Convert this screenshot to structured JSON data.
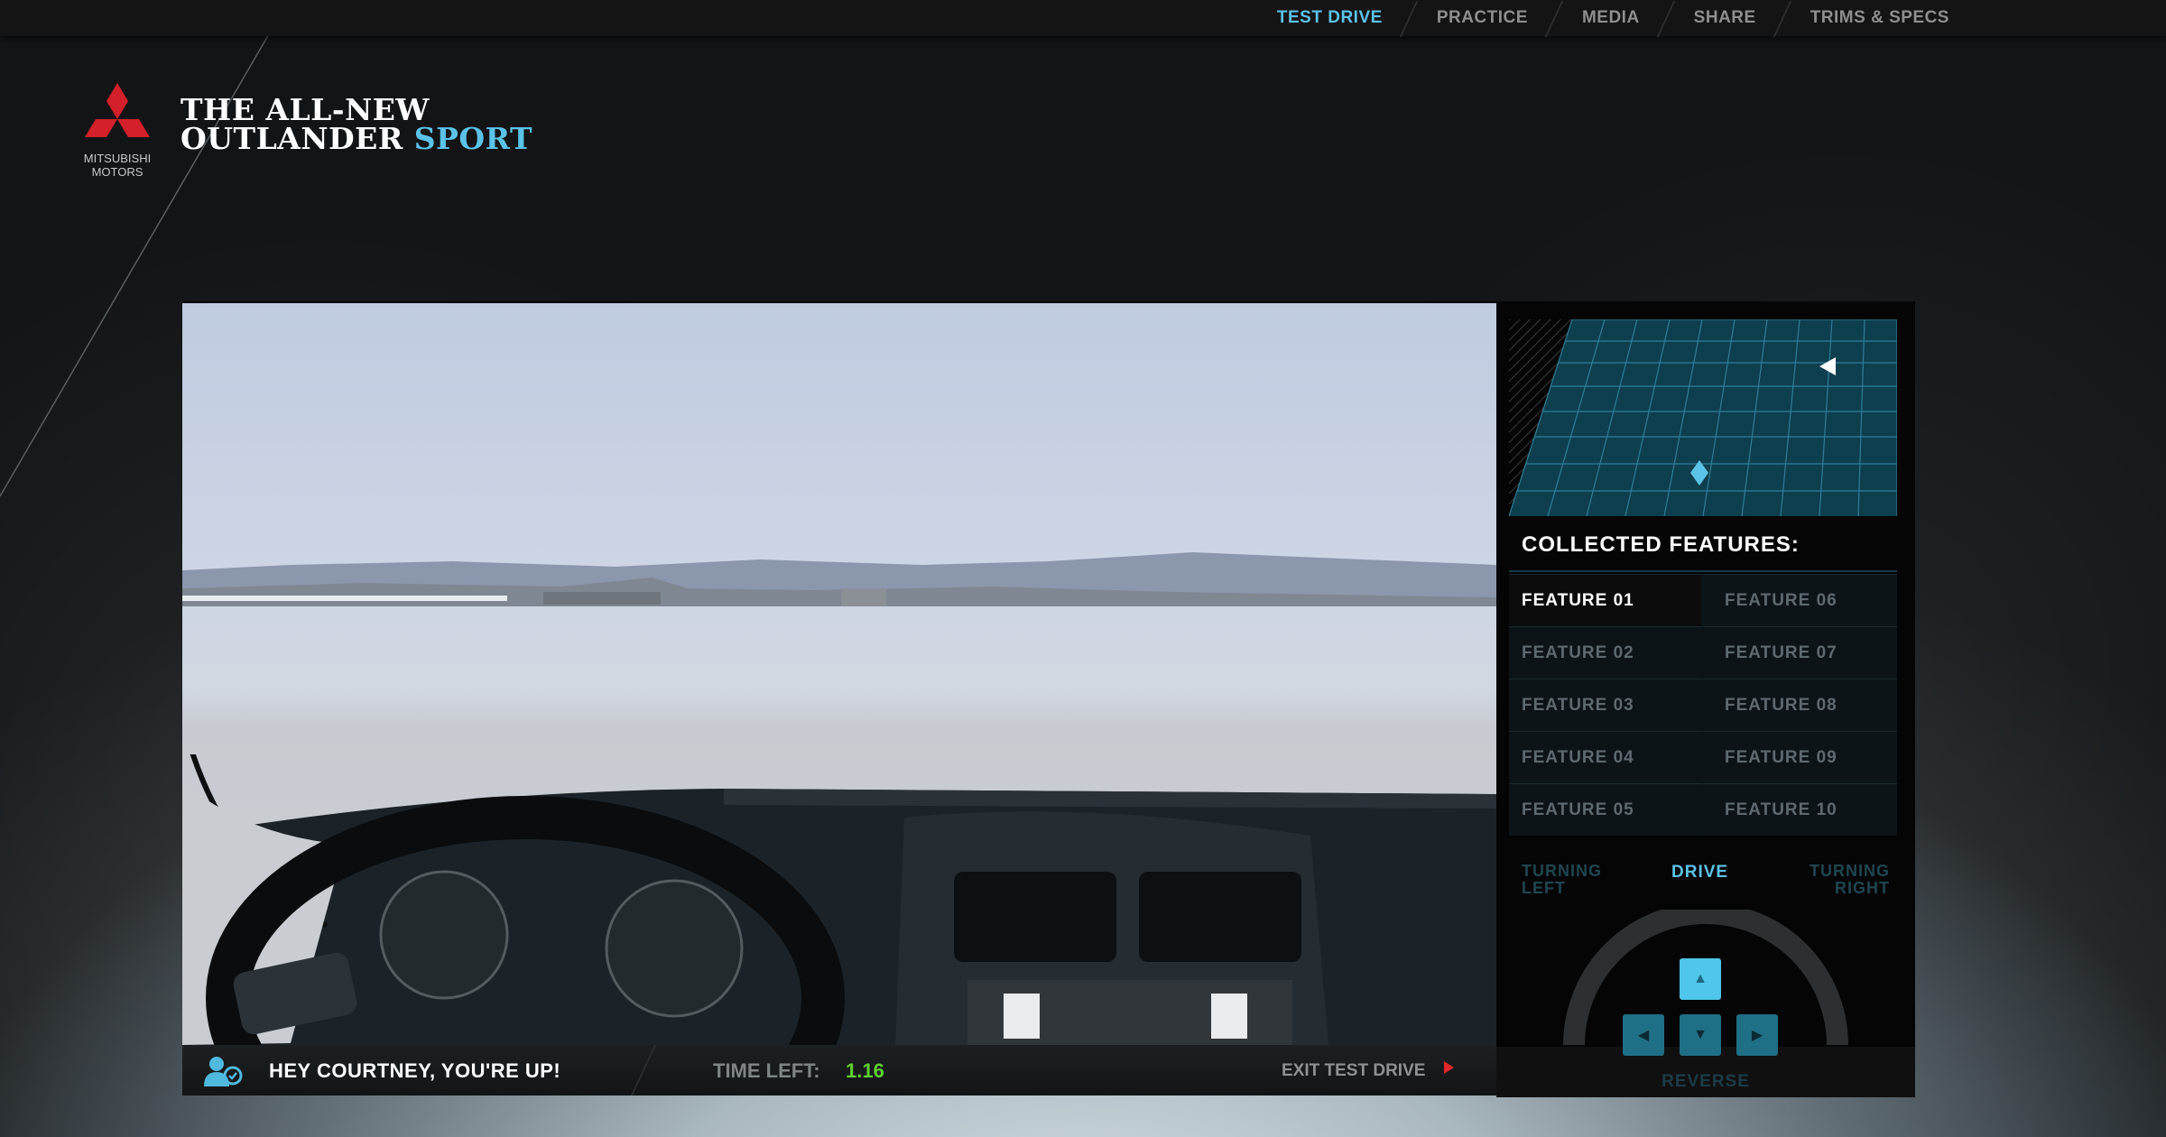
{
  "nav": {
    "items": [
      {
        "label": "TEST DRIVE",
        "active": true
      },
      {
        "label": "PRACTICE",
        "active": false
      },
      {
        "label": "MEDIA",
        "active": false
      },
      {
        "label": "SHARE",
        "active": false
      },
      {
        "label": "TRIMS & SPECS",
        "active": false
      }
    ]
  },
  "brand": {
    "logo_line1": "MITSUBISHI",
    "logo_line2": "MOTORS",
    "headline_line1": "THE ALL-NEW",
    "headline_line2": "OUTLANDER",
    "headline_accent": "SPORT"
  },
  "status": {
    "player_message": "HEY COURTNEY, YOU'RE UP!",
    "time_label": "TIME LEFT:",
    "time_value": "1.16",
    "exit_label": "EXIT TEST DRIVE"
  },
  "features": {
    "title": "COLLECTED FEATURES:",
    "items": [
      {
        "label": "FEATURE 01",
        "collected": true
      },
      {
        "label": "FEATURE 06",
        "collected": false
      },
      {
        "label": "FEATURE 02",
        "collected": false
      },
      {
        "label": "FEATURE 07",
        "collected": false
      },
      {
        "label": "FEATURE 03",
        "collected": false
      },
      {
        "label": "FEATURE 08",
        "collected": false
      },
      {
        "label": "FEATURE 04",
        "collected": false
      },
      {
        "label": "FEATURE 09",
        "collected": false
      },
      {
        "label": "FEATURE 05",
        "collected": false
      },
      {
        "label": "FEATURE 10",
        "collected": false
      }
    ]
  },
  "controls": {
    "turning_left_line1": "TURNING",
    "turning_left_line2": "LEFT",
    "drive": "DRIVE",
    "turning_right_line1": "TURNING",
    "turning_right_line2": "RIGHT",
    "reverse": "REVERSE"
  },
  "colors": {
    "accent": "#5cc3e8",
    "time_green": "#5fd130",
    "brand_red": "#d3202a"
  }
}
